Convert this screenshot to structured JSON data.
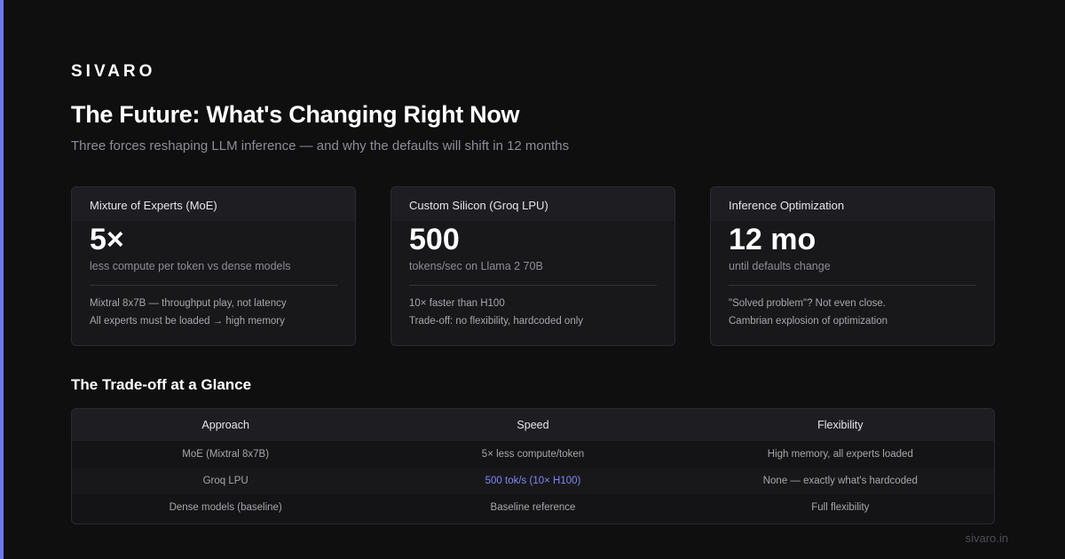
{
  "brand": "SIVARO",
  "title": "The Future: What's Changing Right Now",
  "subtitle": "Three forces reshaping LLM inference — and why the defaults will shift in 12 months",
  "accent_color": "#6f78f0",
  "cards": [
    {
      "heading": "Mixture of Experts (MoE)",
      "stat": "5×",
      "stat_label": "less compute per token vs dense models",
      "notes": [
        "Mixtral 8x7B — throughput play, not latency",
        "All experts must be loaded → high memory"
      ]
    },
    {
      "heading": "Custom Silicon (Groq LPU)",
      "stat": "500",
      "stat_label": "tokens/sec on Llama 2 70B",
      "notes": [
        "10× faster than H100",
        "Trade-off: no flexibility, hardcoded only"
      ]
    },
    {
      "heading": "Inference Optimization",
      "stat": "12 mo",
      "stat_label": "until defaults change",
      "notes": [
        "\"Solved problem\"? Not even close.",
        "Cambrian explosion of optimization"
      ]
    }
  ],
  "tradeoff": {
    "title": "The Trade-off at a Glance",
    "headers": [
      "Approach",
      "Speed",
      "Flexibility"
    ],
    "rows": [
      [
        "MoE (Mixtral 8x7B)",
        "5× less compute/token",
        "High memory, all experts loaded"
      ],
      [
        "Groq LPU",
        "500 tok/s (10× H100)",
        "None — exactly what's hardcoded"
      ],
      [
        "Dense models (baseline)",
        "Baseline reference",
        "Full flexibility"
      ]
    ],
    "highlight_color": "#7f88f5"
  },
  "footer": "sivaro.in"
}
